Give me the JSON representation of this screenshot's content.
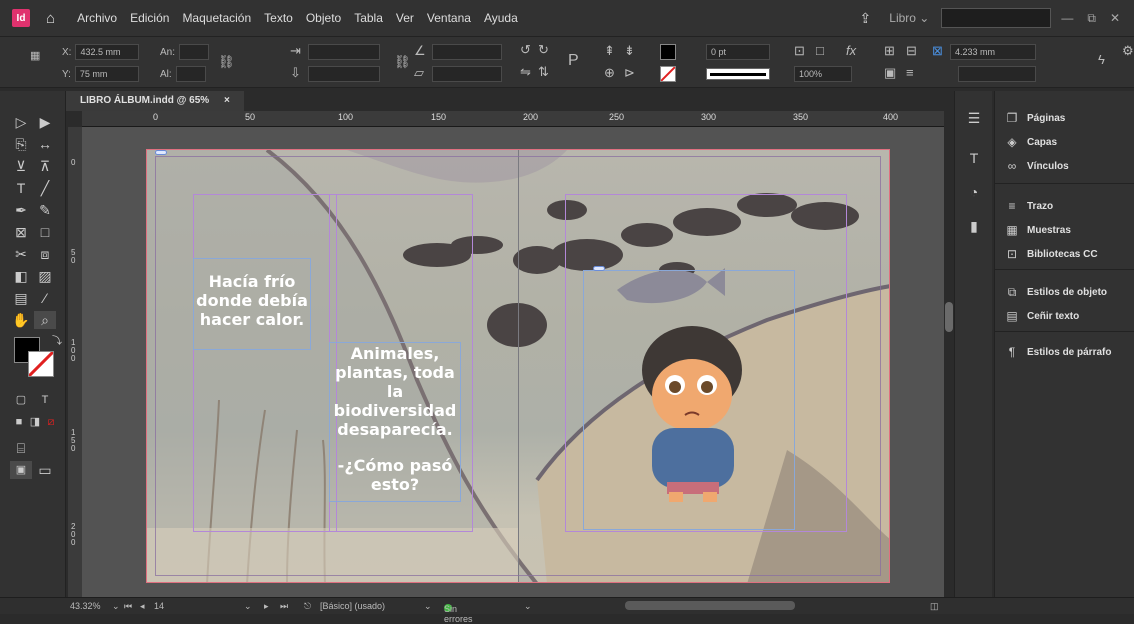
{
  "app": {
    "logo": "Id"
  },
  "menu": [
    "Archivo",
    "Edición",
    "Maquetación",
    "Texto",
    "Objeto",
    "Tabla",
    "Ver",
    "Ventana",
    "Ayuda"
  ],
  "workspace": "Libro",
  "control": {
    "x_label": "X:",
    "x_value": "432.5 mm",
    "y_label": "Y:",
    "y_value": "75 mm",
    "w_label": "An:",
    "h_label": "Al:",
    "stroke_weight": "0 pt",
    "opacity": "100%",
    "gutter": "4.233 mm"
  },
  "document_tab": {
    "title": "LIBRO ÁLBUM.indd @ 65%",
    "close": "×"
  },
  "ruler_h": [
    "0",
    "50",
    "100",
    "150",
    "200",
    "250",
    "300",
    "350",
    "400"
  ],
  "ruler_v": [
    "0",
    "5 0",
    "1 0 0",
    "1 5 0",
    "2 0 0"
  ],
  "stories": {
    "story1": "Hacía frío donde debía hacer calor.",
    "story2": "Animales, plantas, toda la biodiversidad desaparecía.",
    "story3": "-¿Cómo pasó esto?"
  },
  "panels": [
    {
      "label": "Páginas",
      "icon": "pages-icon"
    },
    {
      "label": "Capas",
      "icon": "layers-icon"
    },
    {
      "label": "Vínculos",
      "icon": "links-icon"
    },
    {
      "label": "Trazo",
      "icon": "stroke-icon"
    },
    {
      "label": "Muestras",
      "icon": "swatches-icon"
    },
    {
      "label": "Bibliotecas CC",
      "icon": "cc-libraries-icon"
    },
    {
      "label": "Estilos de objeto",
      "icon": "object-styles-icon"
    },
    {
      "label": "Ceñir texto",
      "icon": "text-wrap-icon"
    },
    {
      "label": "Estilos de párrafo",
      "icon": "paragraph-styles-icon"
    }
  ],
  "status": {
    "zoom": "43.32%",
    "page": "14",
    "master": "[Básico] (usado)",
    "preflight": "Sin errores"
  },
  "colors": {
    "accent": "#e0326e",
    "ok": "#3fb83f",
    "ui_bg": "#323232"
  }
}
